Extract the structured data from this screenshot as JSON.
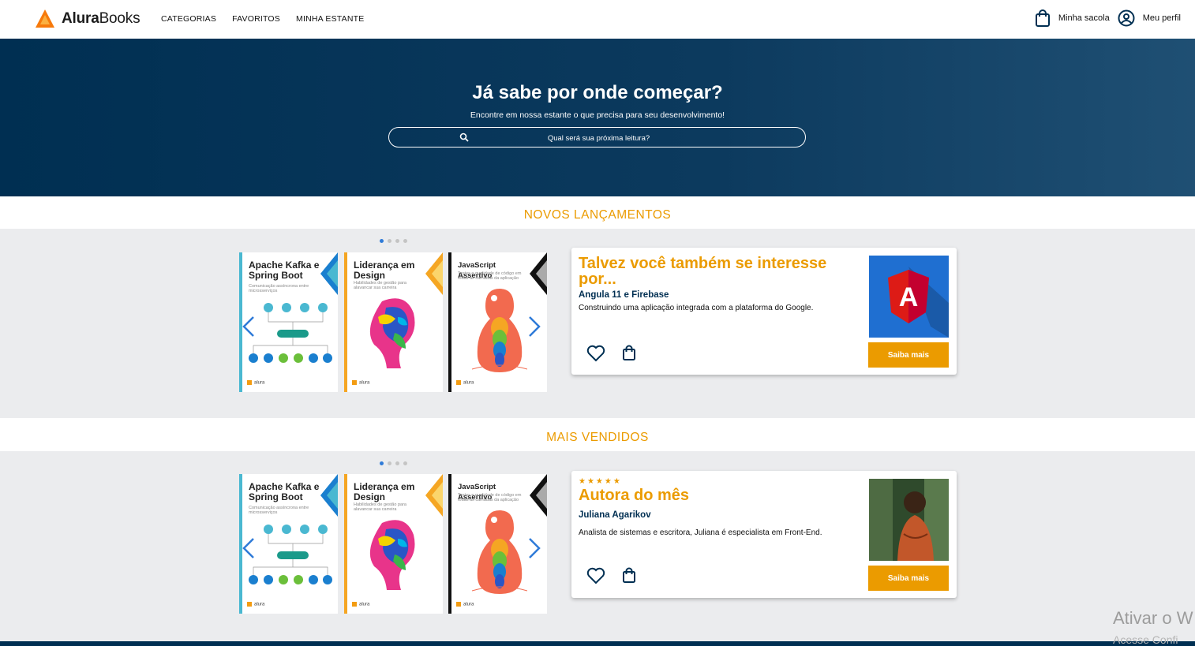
{
  "header": {
    "logo_part1": "Alura",
    "logo_part2": "Books",
    "nav": [
      "CATEGORIAS",
      "FAVORITOS",
      "MINHA ESTANTE"
    ],
    "bag_label": "Minha sacola",
    "profile_label": "Meu perfil"
  },
  "hero": {
    "title": "Já sabe por onde começar?",
    "subtitle": "Encontre em nossa estante o que precisa para seu desenvolvimento!",
    "search_placeholder": "Qual será sua próxima leitura?"
  },
  "books": [
    {
      "title": "Apache Kafka e Spring Boot",
      "subtitle": "Comunicação assíncrona entre microsserviços",
      "accent": "#4ab8d1",
      "footer": "alura"
    },
    {
      "title": "Liderança em Design",
      "subtitle": "Habilidades de gestão para alavancar sua carreira",
      "accent": "#f5a623",
      "footer": "alura"
    },
    {
      "title": "JavaScript Assertivo",
      "subtitle": "Testes e qualidade de código em todas as camadas da aplicação",
      "accent": "#111111",
      "footer": "alura"
    }
  ],
  "sections": [
    {
      "title": "NOVOS LANÇAMENTOS",
      "card": {
        "title": "Talvez você também se interesse por...",
        "name": "Angula 11 e Firebase",
        "description": "Construindo uma aplicação integrada com a plataforma do Google.",
        "button": "Saiba mais",
        "image_icon": "angular-logo-icon"
      }
    },
    {
      "title": "MAIS VENDIDOS",
      "card": {
        "stars": "★★★★★",
        "rating": 5,
        "title": "Autora do mês",
        "name": "Juliana Agarikov",
        "description": "Analista de sistemas e escritora, Juliana é especialista em Front-End.",
        "button": "Saiba mais",
        "image_icon": "author-photo"
      }
    }
  ],
  "watermark": {
    "line1": "Ativar o W",
    "line2": "Acesse Confi"
  },
  "colors": {
    "primary": "#002f52",
    "accent": "#eb9b00",
    "band": "#ebecee"
  }
}
